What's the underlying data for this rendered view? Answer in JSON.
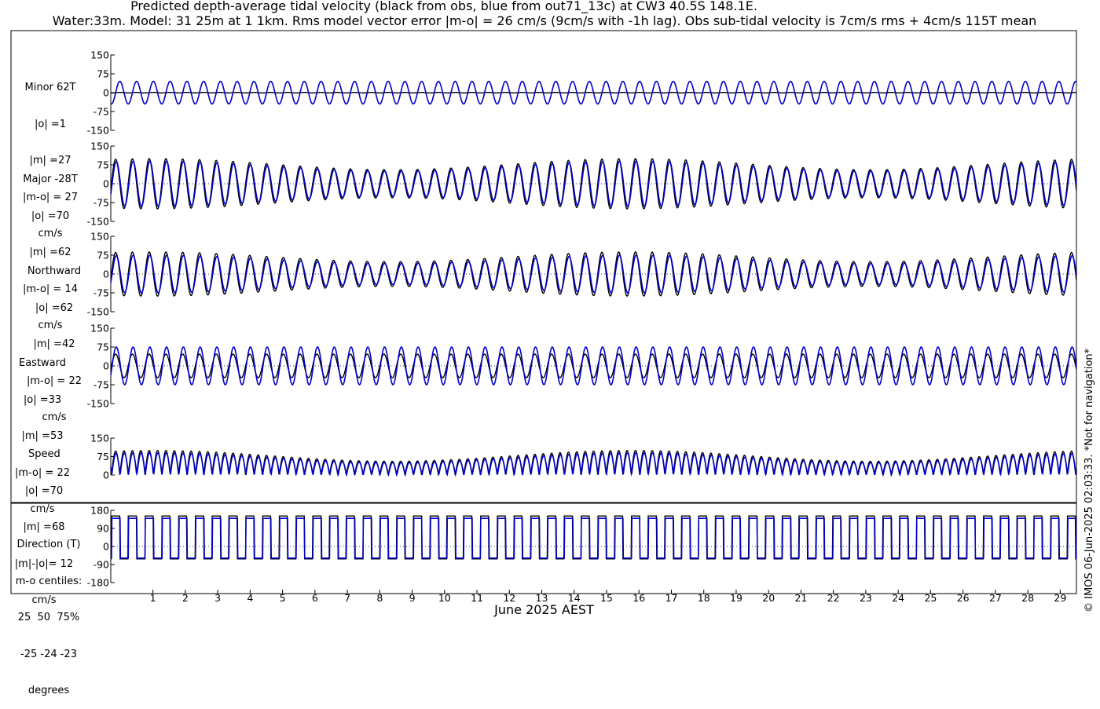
{
  "header": {
    "title_line1": "Predicted depth-average tidal velocity (black from obs, blue from out71_13c) at CW3 40.5S 148.1E.",
    "title_line2": "Water:33m. Model: 31 25m at 1 1km. Rms model vector error |m-o| = 26 cm/s (9cm/s with -1h lag). Obs sub-tidal velocity is 7cm/s rms + 4cm/s 115T mean"
  },
  "xlabel": "June 2025 AEST",
  "credit": "© IMOS 06-Jun-2025 02:03:33. *Not for navigation*",
  "colors": {
    "obs": "#000000",
    "model": "#0000cc"
  },
  "chart_data": {
    "type": "line",
    "x_axis": {
      "unit": "day of June 2025",
      "range": [
        0.2,
        30.0
      ],
      "tick_labels": [
        "1",
        "2",
        "3",
        "4",
        "5",
        "6",
        "7",
        "8",
        "9",
        "10",
        "11",
        "12",
        "13",
        "14",
        "15",
        "16",
        "17",
        "18",
        "19",
        "20",
        "21",
        "22",
        "23",
        "24",
        "25",
        "26",
        "27",
        "28",
        "29"
      ]
    },
    "series_legend": {
      "obs": "black from obs",
      "model": "blue from out71_13c"
    },
    "panels": [
      {
        "key": "minor",
        "label_lines": [
          "Minor 62T",
          "|o| =1",
          "|m| =27",
          "|m-o| = 27",
          "cm/s"
        ],
        "yticks": [
          "150",
          "75",
          "0",
          "-75",
          "-150"
        ],
        "ylim": [
          -150,
          150
        ],
        "obs_amplitude": 1,
        "model_amplitude": 45
      },
      {
        "key": "major",
        "label_lines": [
          "Major -28T",
          "|o| =70",
          "|m| =62",
          "|m-o| = 14",
          "cm/s"
        ],
        "yticks": [
          "150",
          "75",
          "0",
          "-75",
          "-150"
        ],
        "ylim": [
          -150,
          150
        ],
        "obs_amplitude": 100,
        "model_amplitude": 90
      },
      {
        "key": "north",
        "label_lines": [
          "Northward",
          "|o| =62",
          "|m| =42",
          "|m-o| = 22",
          "cm/s"
        ],
        "yticks": [
          "150",
          "75",
          "0",
          "-75",
          "-150"
        ],
        "ylim": [
          -150,
          150
        ],
        "obs_amplitude": 88,
        "model_amplitude": 75
      },
      {
        "key": "east",
        "label_lines": [
          "Eastward",
          "|o| =33",
          "|m| =53",
          "|m-o| = 22",
          "cm/s"
        ],
        "yticks": [
          "150",
          "75",
          "0",
          "-75",
          "-150"
        ],
        "ylim": [
          -150,
          150
        ],
        "obs_amplitude": 47,
        "model_amplitude": 75
      },
      {
        "key": "speed",
        "label_lines": [
          "Speed",
          "|o| =70",
          "|m| =68",
          "|m|-|o|= 12",
          "cm/s"
        ],
        "yticks": [
          "150",
          "75",
          "0"
        ],
        "ylim": [
          0,
          150
        ],
        "obs_amplitude": 100,
        "model_amplitude": 90
      },
      {
        "key": "direction",
        "label_lines": [
          "Direction (T)",
          "m-o centiles:",
          "25  50  75%",
          "-25 -24 -23",
          "degrees"
        ],
        "yticks": [
          "180",
          "90",
          "0",
          "-90",
          "-180"
        ],
        "ylim": [
          -180,
          180
        ],
        "obs_levels": [
          152,
          -62
        ],
        "model_levels": [
          140,
          -58
        ]
      }
    ]
  }
}
